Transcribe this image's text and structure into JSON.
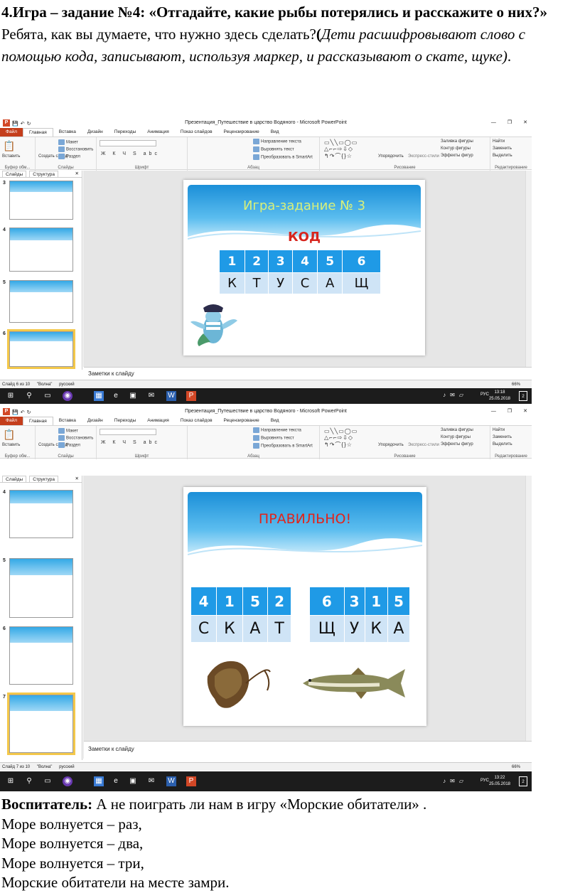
{
  "intro": {
    "bold_lead": "4.Игра – задание №4: «Отгадайте, какие рыбы потерялись и расскажите о них?»",
    "plain": " Ребята, как вы думаете, что нужно здесь сделать?",
    "paren_open": "(",
    "italic": "Дети расшифровывают слово с помощью кода, записывают, используя маркер, и рассказывают о скате, щуке)",
    "tail": "."
  },
  "ppt": {
    "window_title": "Презентация_Путешествие в царство Водяного - Microsoft PowerPoint",
    "tabs": [
      "Файл",
      "Главная",
      "Вставка",
      "Дизайн",
      "Переходы",
      "Анимация",
      "Показ слайдов",
      "Рецензирование",
      "Вид"
    ],
    "ribbon": {
      "clipboard": {
        "paste": "Вставить",
        "label": "Буфер обм..."
      },
      "slides": {
        "new": "Создать слайд",
        "layout": "Макет",
        "reset": "Восстановить",
        "section": "Раздел",
        "label": "Слайды"
      },
      "font": {
        "label": "Шрифт"
      },
      "paragraph": {
        "direction": "Направление текста",
        "align": "Выровнять текст",
        "smartart": "Преобразовать в SmartArt",
        "label": "Абзац"
      },
      "drawing": {
        "arrange": "Упорядочить",
        "styles": "Экспресс-стили",
        "fill": "Заливка фигуры",
        "outline": "Контур фигуры",
        "effects": "Эффекты фигур",
        "label": "Рисование"
      },
      "editing": {
        "find": "Найти",
        "replace": "Заменить",
        "select": "Выделить",
        "label": "Редактирование"
      }
    },
    "side_tabs": [
      "Слайды",
      "Структура"
    ],
    "notes_label": "Заметки к слайду",
    "theme": "\"Волна\"",
    "language": "русский",
    "keyboard_lang": "РУС"
  },
  "shot1": {
    "thumbs": [
      "3",
      "4",
      "5",
      "6"
    ],
    "status_slide": "Слайд 6 из 10",
    "zoom": "66%",
    "time": "13:18",
    "date": "25.05.2018",
    "slide": {
      "title": "Игра-задание № 3",
      "code_label": "КОД",
      "numbers": [
        "1",
        "2",
        "3",
        "4",
        "5",
        "6"
      ],
      "letters": [
        "К",
        "Т",
        "У",
        "С",
        "А",
        "Щ"
      ]
    }
  },
  "shot2": {
    "thumbs": [
      "4",
      "5",
      "6",
      "7"
    ],
    "status_slide": "Слайд 7 из 10",
    "zoom": "66%",
    "time": "13:22",
    "date": "25.05.2018",
    "slide": {
      "title": "ПРАВИЛЬНО!",
      "word1_numbers": [
        "4",
        "1",
        "5",
        "2"
      ],
      "word1_letters": [
        "С",
        "К",
        "А",
        "Т"
      ],
      "word2_numbers": [
        "6",
        "3",
        "1",
        "5"
      ],
      "word2_letters": [
        "Щ",
        "У",
        "К",
        "А"
      ]
    }
  },
  "bottom": {
    "lead": "Воспитатель:",
    "lead_rest": " А не поиграть ли нам в игру «Морские обитатели» .",
    "lines": [
      "Море волнуется – раз,",
      "Море волнуется – два,",
      "Море волнуется – три,",
      "Морские обитатели на месте замри."
    ]
  },
  "colors": {
    "accent": "#1f9ae6",
    "file_tab": "#c43e1c",
    "code_red": "#d7261e",
    "title_green": "#d8f07a",
    "title_red": "#e2231a"
  }
}
